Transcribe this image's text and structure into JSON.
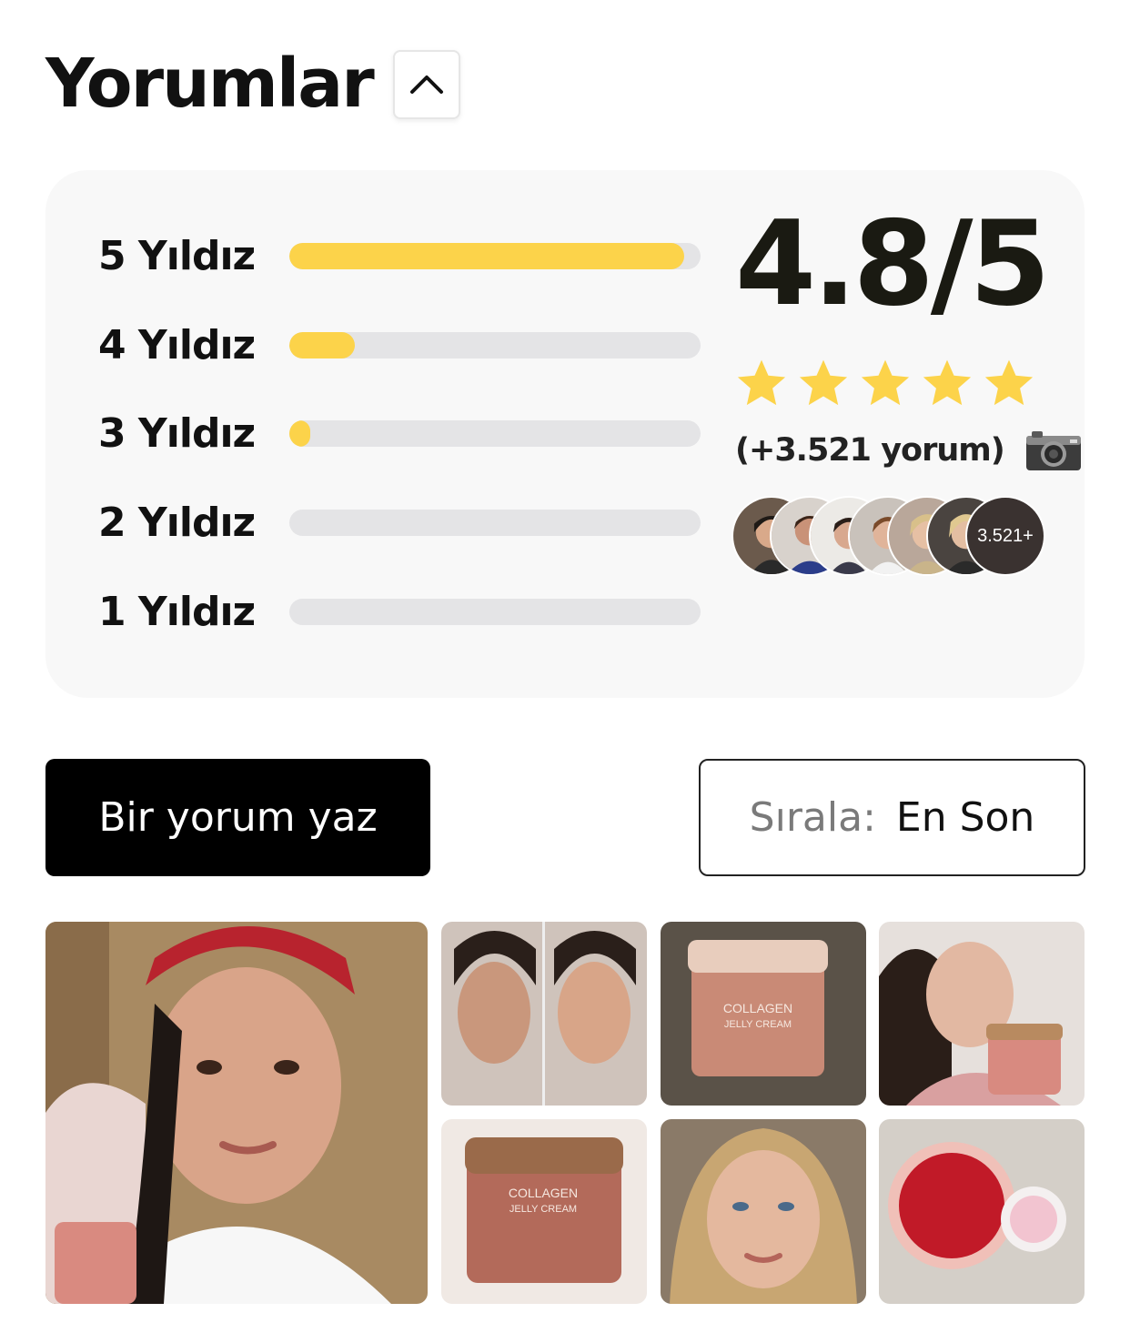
{
  "header": {
    "title": "Yorumlar",
    "collapse_icon": "chevron-up-icon"
  },
  "ratings": {
    "rows": [
      {
        "label": "5 Yıldız",
        "fraction": 0.96
      },
      {
        "label": "4 Yıldız",
        "fraction": 0.16
      },
      {
        "label": "3 Yıldız",
        "fraction": 0.05
      },
      {
        "label": "2 Yıldız",
        "fraction": 0
      },
      {
        "label": "1 Yıldız",
        "fraction": 0
      }
    ],
    "bar_color": "#fcd34a",
    "score": "4.8/5",
    "stars": 5,
    "star_color": "#fcd34a",
    "review_count": "(+3.521 yorum)",
    "camera_icon": "camera-icon",
    "avatar_more": "3.521+"
  },
  "actions": {
    "write_review": "Bir yorum yaz",
    "sort_label": "Sırala:",
    "sort_value": "En Son"
  }
}
